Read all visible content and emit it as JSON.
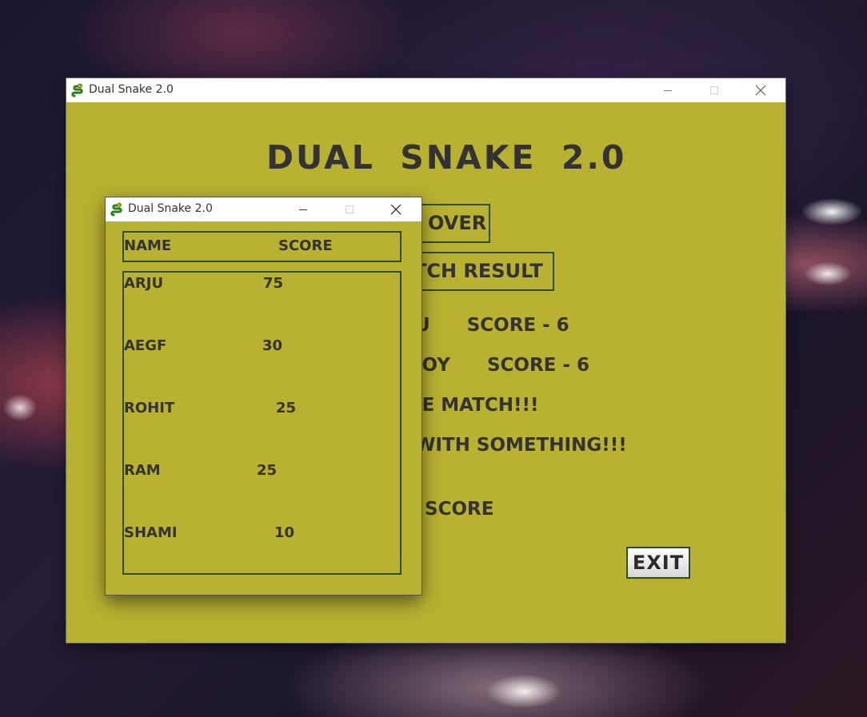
{
  "main_window": {
    "title": "Dual Snake 2.0",
    "heading": "DUAL  SNAKE  2.0",
    "game_over_label": "OVER",
    "match_result_label": "TCH RESULT",
    "player1_name": "U",
    "player1_score": "SCORE - 6",
    "player2_name": "JOY",
    "player2_score": "SCORE - 6",
    "result_text": "IE  MATCH!!!",
    "comeback_text": "WITH SOMETHING!!!",
    "high_score_label": "SCORE",
    "exit_label": "EXIT"
  },
  "popup_window": {
    "title": "Dual Snake 2.0",
    "columns": {
      "name": "NAME",
      "score": "SCORE"
    },
    "entries": [
      {
        "name": "ARJU",
        "score": "75"
      },
      {
        "name": "AEGF",
        "score": "30"
      },
      {
        "name": "ROHIT",
        "score": "25"
      },
      {
        "name": "RAM",
        "score": "25"
      },
      {
        "name": "SHAMI",
        "score": "10"
      }
    ]
  },
  "colors": {
    "window_bg": "#b8b131",
    "text": "#333333",
    "border": "#2d4d22"
  },
  "icons": [
    "snake-icon",
    "minimize-icon",
    "maximize-icon",
    "close-icon"
  ]
}
